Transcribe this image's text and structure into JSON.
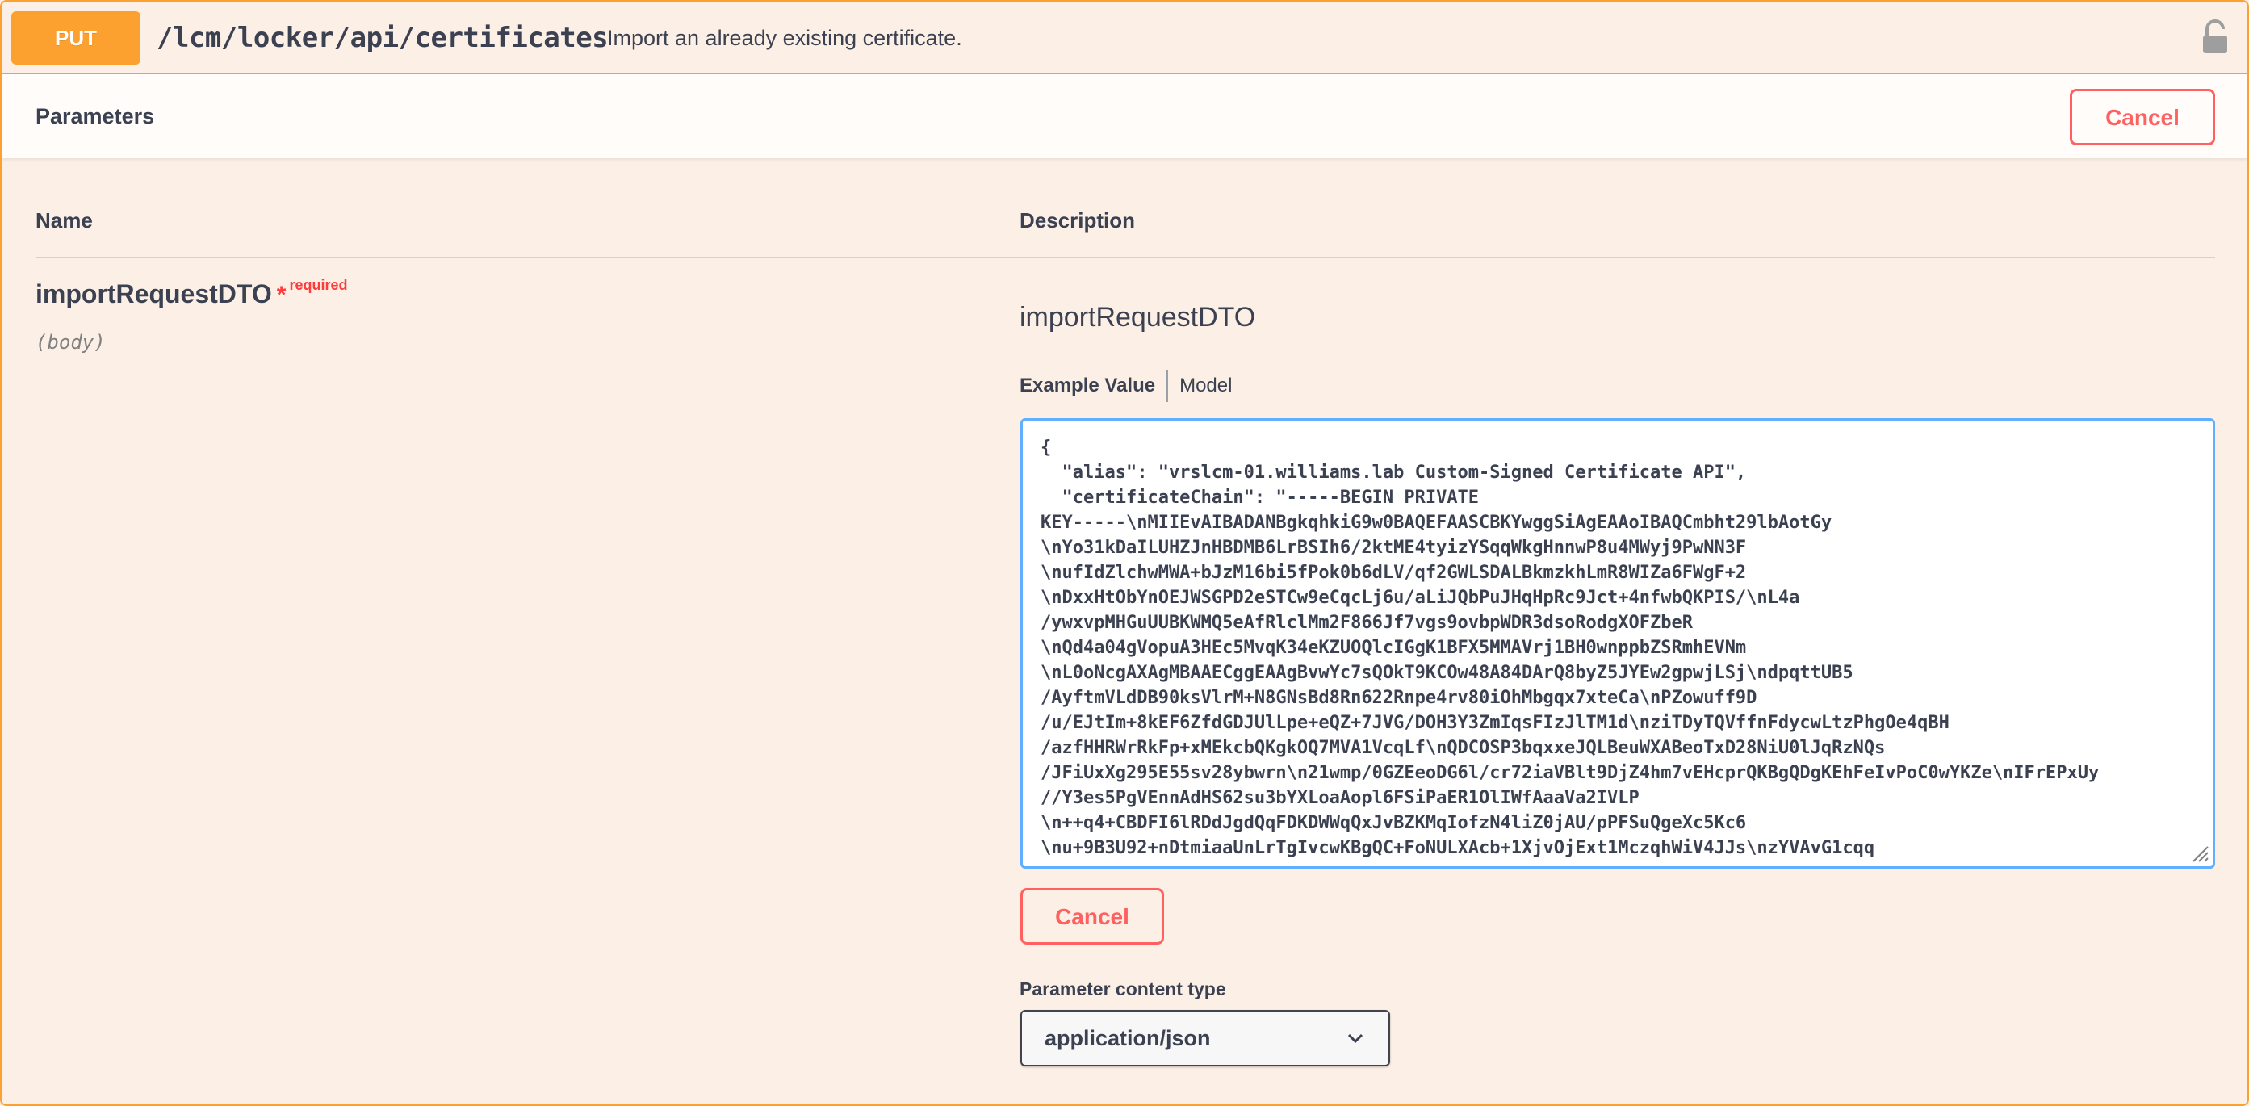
{
  "summary": {
    "method": "PUT",
    "path": "/lcm/locker/api/certificates",
    "description": "Import an already existing certificate.",
    "lock_icon": "lock-icon"
  },
  "parameters_section": {
    "title": "Parameters",
    "cancel_label": "Cancel"
  },
  "table": {
    "name_header": "Name",
    "description_header": "Description"
  },
  "param": {
    "name": "importRequestDTO",
    "required_star": "*",
    "required_label": "required",
    "in": "(body)",
    "description_title": "importRequestDTO",
    "tabs": [
      {
        "label": "Example Value"
      },
      {
        "label": "Model"
      }
    ],
    "body_value": "{\n  \"alias\": \"vrslcm-01.williams.lab Custom-Signed Certificate API\",\n  \"certificateChain\": \"-----BEGIN PRIVATE\nKEY-----\\nMIIEvAIBADANBgkqhkiG9w0BAQEFAASCBKYwggSiAgEAAoIBAQCmbht29lbAotGy\n\\nYo31kDaILUHZJnHBDMB6LrBSIh6/2ktME4tyizYSqqWkgHnnwP8u4MWyj9PwNN3F\n\\nufIdZlchwMWA+bJzM16bi5fPok0b6dLV/qf2GWLSDALBkmzkhLmR8WIZa6FWgF+2\n\\nDxxHtObYnOEJWSGPD2eSTCw9eCqcLj6u/aLiJQbPuJHqHpRc9Jct+4nfwbQKPIS/\\nL4a\n/ywxvpMHGuUUBKWMQ5eAfRlclMm2F866Jf7vgs9ovbpWDR3dsoRodgXOFZbeR\n\\nQd4a04gVopuA3HEc5MvqK34eKZUOQlcIGgK1BFX5MMAVrj1BH0wnppbZSRmhEVNm\n\\nL0oNcgAXAgMBAAECggEAAgBvwYc7sQOkT9KCOw48A84DArQ8byZ5JYEw2gpwjLSj\\ndpqttUB5\n/AyftmVLdDB90ksVlrM+N8GNsBd8Rn622Rnpe4rv80iOhMbgqx7xteCa\\nPZowuff9D\n/u/EJtIm+8kEF6ZfdGDJUlLpe+eQZ+7JVG/DOH3Y3ZmIqsFIzJlTM1d\\nziTDyTQVffnFdycwLtzPhgOe4qBH\n/azfHHRWrRkFp+xMEkcbQKgkOQ7MVA1VcqLf\\nQDCOSP3bqxxeJQLBeuWXABeoTxD28NiU0lJqRzNQs\n/JFiUxXg295E55sv28ybwrn\\n21wmp/0GZEeoDG6l/cr72iaVBlt9DjZ4hm7vEHcprQKBgQDgKEhFeIvPoC0wYKZe\\nIFrEPxUy\n//Y3es5PgVEnnAdHS62su3bYXLoaAopl6FSiPaER1OlIWfAaaVa2IVLP\n\\n++q4+CBDFI6lRDdJgdQqFDKDWWqQxJvBZKMqIofzN4liZ0jAU/pPFSuQgeXc5Kc6\n\\nu+9B3U92+nDtmiaaUnLrTgIvcwKBgQC+FoNULXAcb+1XjvOjExt1MczqhWiV4JJs\\nzYVAvG1cqq"
  },
  "content_type": {
    "label": "Parameter content type",
    "selected": "application/json"
  },
  "colors": {
    "put_accent": "#fca130",
    "cancel_red": "#ff6060",
    "focus_blue": "#61affe",
    "background": "#fcf0e6"
  }
}
